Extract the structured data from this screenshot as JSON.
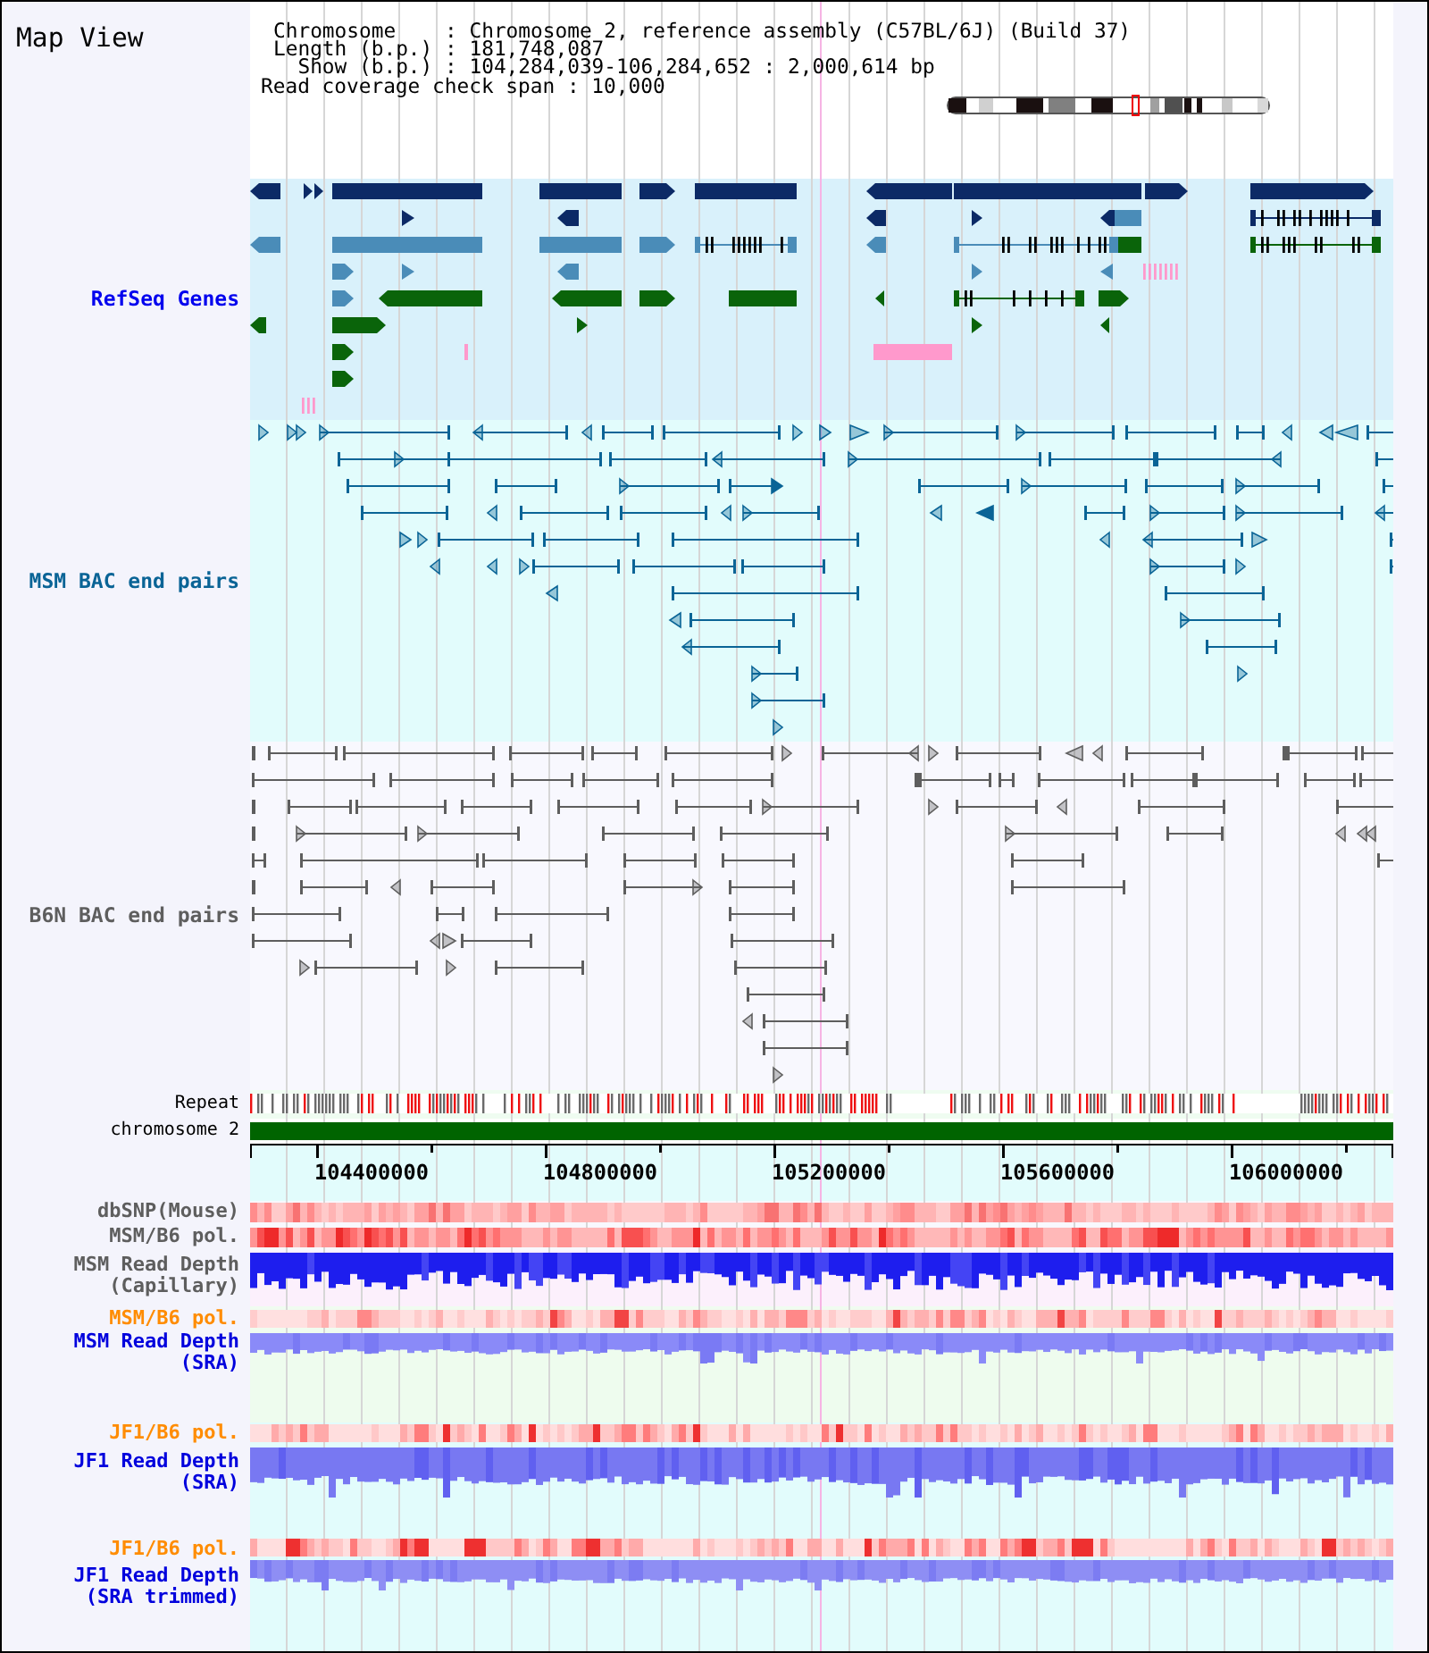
{
  "title": "Map View",
  "info": {
    "lines": [
      "Chromosome    : Chromosome 2, reference assembly (C57BL/6J) (Build 37)",
      "Length (b.p.) : 181,748,087",
      "  Show (b.p.) : 104,284,039-106,284,652 : 2,000,614 bp"
    ],
    "span_line": "Read coverage check span : 10,000"
  },
  "tracks": [
    {
      "kind": "genes",
      "label": "RefSeq Genes",
      "color": "#0000ee"
    },
    {
      "kind": "pairs",
      "label": "MSM BAC end pairs",
      "color": "#0a6496"
    },
    {
      "kind": "pairs",
      "label": "B6N BAC end pairs",
      "color": "#5e5e5e"
    },
    {
      "kind": "repeat",
      "label": "Repeat",
      "color": "#000000"
    },
    {
      "kind": "chromosome",
      "label": "chromosome 2",
      "color": "#000000"
    },
    {
      "kind": "axis",
      "ticks": [
        "104400000",
        "104800000",
        "105200000",
        "105600000",
        "106000000"
      ]
    },
    {
      "kind": "heat",
      "label": "dbSNP(Mouse)",
      "color": "#5e5e5e"
    },
    {
      "kind": "heat",
      "label": "MSM/B6 pol.",
      "color": "#5e5e5e"
    },
    {
      "kind": "depth",
      "label": "MSM Read Depth",
      "sublabel": "(Capillary)",
      "color": "#5e5e5e"
    },
    {
      "kind": "heat",
      "label": "MSM/B6 pol.",
      "color": "#ff8c00"
    },
    {
      "kind": "depth",
      "label": "MSM Read Depth",
      "sublabel": "(SRA)",
      "color": "#0000dd"
    },
    {
      "kind": "heat",
      "label": "JF1/B6 pol.",
      "color": "#ff8c00"
    },
    {
      "kind": "depth",
      "label": "JF1 Read Depth",
      "sublabel": "(SRA)",
      "color": "#0000dd"
    },
    {
      "kind": "heat",
      "label": "JF1/B6 pol.",
      "color": "#ff8c00"
    },
    {
      "kind": "depth",
      "label": "JF1 Read Depth",
      "sublabel": "(SRA trimmed)",
      "color": "#0000dd"
    }
  ]
}
